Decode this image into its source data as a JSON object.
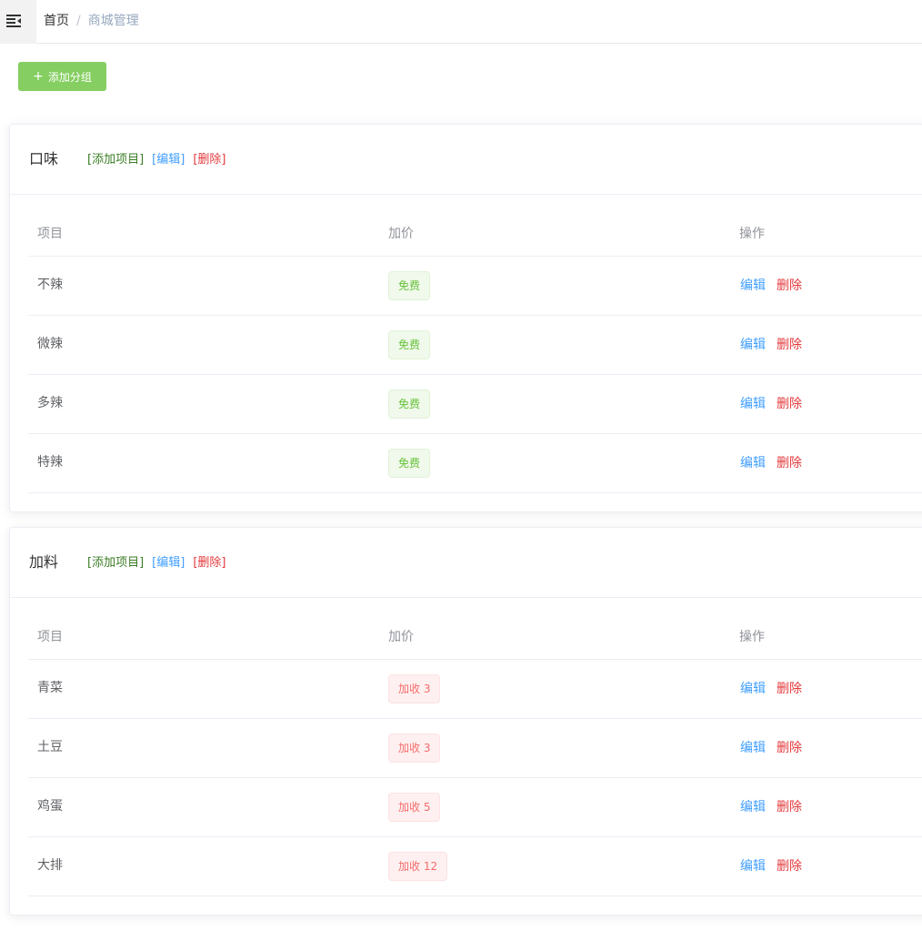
{
  "breadcrumb": {
    "home": "首页",
    "separator": "/",
    "current": "商城管理"
  },
  "toolbar": {
    "add_group_label": "添加分组",
    "add_group_icon": "plus-icon",
    "menu_icon": "hamburger-fold-icon"
  },
  "colors": {
    "primary": "#409eff",
    "success_btn": "#85ce61",
    "danger": "#e4393c",
    "add_link": "#3a7d24"
  },
  "groups": [
    {
      "title": "口味",
      "actions": {
        "add": "[添加项目]",
        "edit": "[编辑]",
        "delete": "[删除]"
      },
      "columns": {
        "item": "项目",
        "price": "加价",
        "ops": "操作"
      },
      "rows": [
        {
          "name": "不辣",
          "price": "免费",
          "price_type": "free",
          "edit": "编辑",
          "delete": "删除"
        },
        {
          "name": "微辣",
          "price": "免费",
          "price_type": "free",
          "edit": "编辑",
          "delete": "删除"
        },
        {
          "name": "多辣",
          "price": "免费",
          "price_type": "free",
          "edit": "编辑",
          "delete": "删除"
        },
        {
          "name": "特辣",
          "price": "免费",
          "price_type": "free",
          "edit": "编辑",
          "delete": "删除"
        }
      ]
    },
    {
      "title": "加料",
      "actions": {
        "add": "[添加项目]",
        "edit": "[编辑]",
        "delete": "[删除]"
      },
      "columns": {
        "item": "项目",
        "price": "加价",
        "ops": "操作"
      },
      "rows": [
        {
          "name": "青菜",
          "price": "加收 3",
          "price_type": "extra",
          "edit": "编辑",
          "delete": "删除"
        },
        {
          "name": "土豆",
          "price": "加收 3",
          "price_type": "extra",
          "edit": "编辑",
          "delete": "删除"
        },
        {
          "name": "鸡蛋",
          "price": "加收 5",
          "price_type": "extra",
          "edit": "编辑",
          "delete": "删除"
        },
        {
          "name": "大排",
          "price": "加收 12",
          "price_type": "extra",
          "edit": "编辑",
          "delete": "删除"
        }
      ]
    }
  ]
}
